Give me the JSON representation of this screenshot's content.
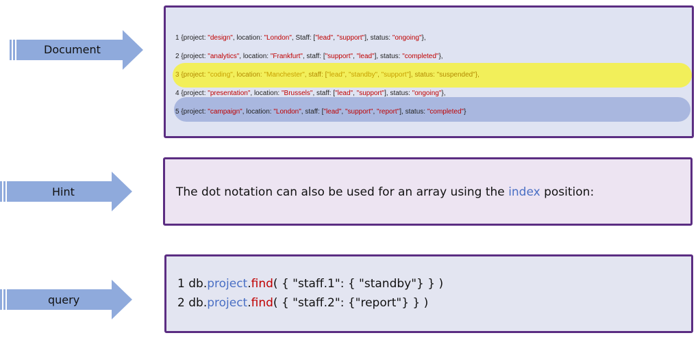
{
  "arrows": [
    {
      "label": "Document"
    },
    {
      "label": "Hint"
    },
    {
      "label": "query"
    }
  ],
  "document": {
    "lines": [
      {
        "parts": [
          {
            "t": "1 {project: "
          },
          {
            "t": "\"design\"",
            "s": 1
          },
          {
            "t": ", location: "
          },
          {
            "t": "\"London\"",
            "s": 1
          },
          {
            "t": ", Staff: ["
          },
          {
            "t": "\"lead\"",
            "s": 1
          },
          {
            "t": ", "
          },
          {
            "t": "\"support\"",
            "s": 1
          },
          {
            "t": "], status: "
          },
          {
            "t": "\"ongoing\"",
            "s": 1
          },
          {
            "t": "},"
          }
        ]
      },
      {
        "parts": [
          {
            "t": "2 {project: "
          },
          {
            "t": "\"analytics\"",
            "s": 1
          },
          {
            "t": ", location: "
          },
          {
            "t": "\"Frankfurt\"",
            "s": 1
          },
          {
            "t": ", staff: ["
          },
          {
            "t": "\"support\"",
            "s": 1
          },
          {
            "t": ", "
          },
          {
            "t": "\"lead\"",
            "s": 1
          },
          {
            "t": "], status: "
          },
          {
            "t": "\"completed\"",
            "s": 1
          },
          {
            "t": "},"
          }
        ]
      },
      {
        "parts": [
          {
            "t": "3 {project: "
          },
          {
            "t": "\"coding\"",
            "s": 1
          },
          {
            "t": ", location: "
          },
          {
            "t": "\"Manchester\"",
            "s": 1
          },
          {
            "t": ", staff: ["
          },
          {
            "t": "\"lead\"",
            "s": 1
          },
          {
            "t": ", "
          },
          {
            "t": "\"standby\"",
            "s": 1
          },
          {
            "t": ", "
          },
          {
            "t": "\"support\"",
            "s": 1
          },
          {
            "t": "], status: \"suspended\"},"
          }
        ]
      },
      {
        "parts": [
          {
            "t": "4 {project: "
          },
          {
            "t": "\"presentation\"",
            "s": 1
          },
          {
            "t": ", location: "
          },
          {
            "t": "\"Brussels\"",
            "s": 1
          },
          {
            "t": ", staff: ["
          },
          {
            "t": "\"lead\"",
            "s": 1
          },
          {
            "t": ", "
          },
          {
            "t": "\"support\"",
            "s": 1
          },
          {
            "t": "], status: "
          },
          {
            "t": "\"ongoing\"",
            "s": 1
          },
          {
            "t": "},"
          }
        ]
      },
      {
        "parts": [
          {
            "t": "5 {project: "
          },
          {
            "t": "\"campaign\"",
            "s": 1
          },
          {
            "t": ", location: "
          },
          {
            "t": "\"London\"",
            "s": 1
          },
          {
            "t": ", staff: ["
          },
          {
            "t": "\"lead\"",
            "s": 1
          },
          {
            "t": ", "
          },
          {
            "t": "\"support\"",
            "s": 1
          },
          {
            "t": ", "
          },
          {
            "t": "\"report\"",
            "s": 1
          },
          {
            "t": "], status: "
          },
          {
            "t": "\"completed\"",
            "s": 1
          },
          {
            "t": "}"
          }
        ]
      }
    ]
  },
  "hint": {
    "before": "The dot notation can also be used for an array using the ",
    "keyword": "index",
    "after": " position:"
  },
  "query": {
    "lines": [
      {
        "num": "1",
        "db": " db.",
        "collection": "project",
        "dot": ".",
        "method": "find",
        "args": "( { \"staff.1\": { \"standby\"} } )"
      },
      {
        "num": "2",
        "db": " db.",
        "collection": "project",
        "dot": ".",
        "method": "find",
        "args": "( { \"staff.2\": {\"report\"} } )"
      }
    ]
  },
  "colors": {
    "panel_border": "#5b2d82",
    "arrow_fill": "#8faadc",
    "string_red": "#c00000",
    "keyword_blue": "#4a6fc4",
    "highlight_yellow": "#f2ef5a",
    "highlight_blue": "#a9b7df"
  }
}
